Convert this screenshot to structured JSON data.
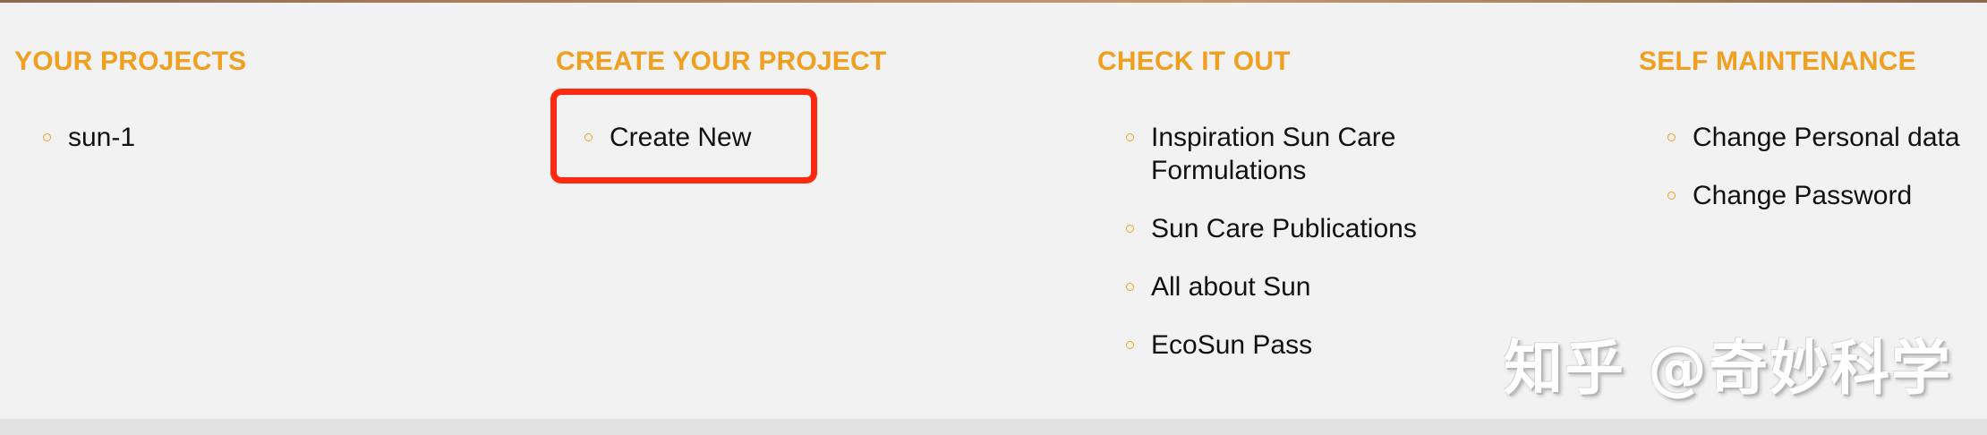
{
  "columns": [
    {
      "title": "YOUR PROJECTS",
      "items": [
        {
          "label": "sun-1"
        }
      ]
    },
    {
      "title": "CREATE YOUR PROJECT",
      "items": [
        {
          "label": "Create New"
        }
      ]
    },
    {
      "title": "CHECK IT OUT",
      "items": [
        {
          "label": "Inspiration Sun Care Formulations"
        },
        {
          "label": "Sun Care Publications"
        },
        {
          "label": "All about Sun"
        },
        {
          "label": "EcoSun Pass"
        }
      ]
    },
    {
      "title": "SELF MAINTENANCE",
      "items": [
        {
          "label": "Change Personal data"
        },
        {
          "label": "Change Password"
        }
      ]
    }
  ],
  "watermark": "知乎 @奇妙科学",
  "colors": {
    "accent": "#f0a020",
    "highlight": "#ff2a10",
    "background": "#f2f2f2",
    "text": "#111111"
  }
}
